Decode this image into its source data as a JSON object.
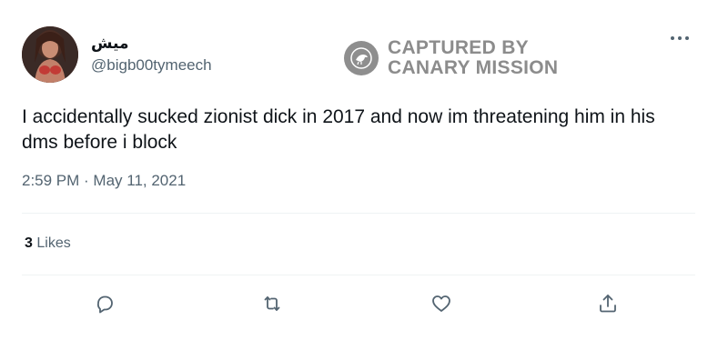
{
  "tweet": {
    "display_name": "ميش",
    "handle": "@bigb00tymeech",
    "text": "I accidentally sucked zionist dick in 2017 and now im threatening him in his dms before i block",
    "timestamp": "2:59 PM · May 11, 2021",
    "likes_count": "3",
    "likes_label": "Likes"
  },
  "watermark": {
    "line1": "CAPTURED BY",
    "line2": "CANARY MISSION"
  },
  "icons": {
    "more": "more-horizontal-icon",
    "reply": "reply-icon",
    "retweet": "retweet-icon",
    "like": "heart-icon",
    "share": "share-icon"
  },
  "colors": {
    "primary_text": "#0f1419",
    "secondary_text": "#536471",
    "watermark": "#8c8c8c",
    "divider": "#eff3f4"
  }
}
